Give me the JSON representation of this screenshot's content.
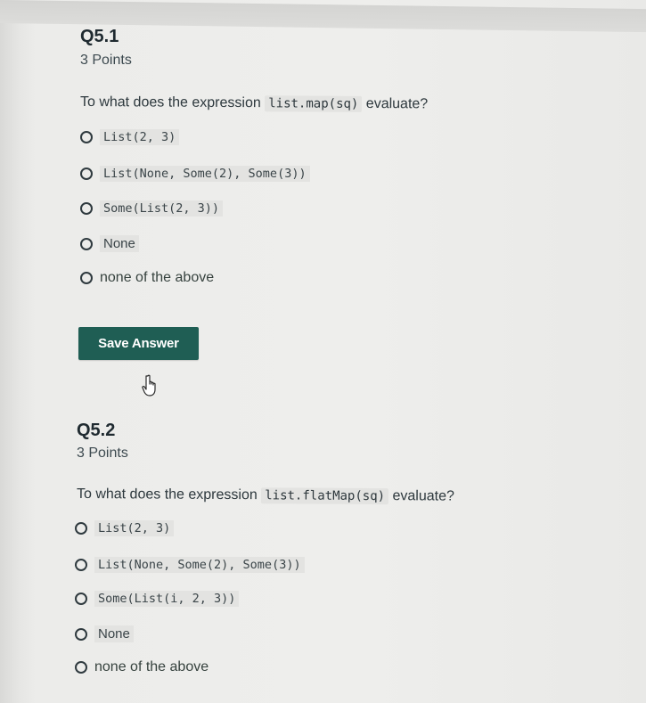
{
  "q1": {
    "title": "Q5.1",
    "points": "3 Points",
    "prompt_before": "To what does the expression ",
    "prompt_code": "list.map(sq)",
    "prompt_after": " evaluate?",
    "options": [
      {
        "label": "List(2, 3)",
        "is_code": true
      },
      {
        "label": "List(None, Some(2), Some(3))",
        "is_code": true
      },
      {
        "label": "Some(List(2, 3))",
        "is_code": true
      },
      {
        "label": "None",
        "is_code": false
      },
      {
        "label": "none of the above",
        "is_code": false
      }
    ],
    "save_label": "Save Answer"
  },
  "q2": {
    "title": "Q5.2",
    "points": "3 Points",
    "prompt_before": "To what does the expression ",
    "prompt_code": "list.flatMap(sq)",
    "prompt_after": " evaluate?",
    "options": [
      {
        "label": "List(2, 3)",
        "is_code": true
      },
      {
        "label": "List(None, Some(2), Some(3))",
        "is_code": true
      },
      {
        "label": "Some(List(i, 2, 3))",
        "is_code": true
      },
      {
        "label": "None",
        "is_code": false
      },
      {
        "label": "none of the above",
        "is_code": false
      }
    ]
  },
  "colors": {
    "save_button_bg": "#1f5e54",
    "text": "#2f3a3f"
  },
  "icons": {
    "cursor": "hand-pointer-icon"
  }
}
